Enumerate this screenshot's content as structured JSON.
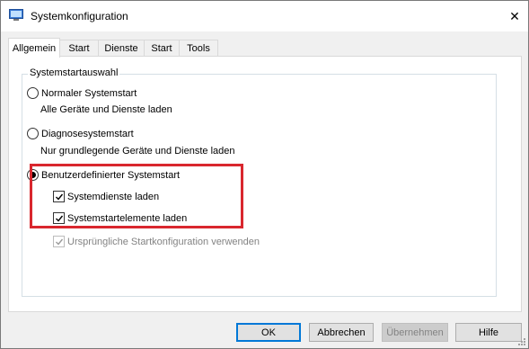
{
  "window": {
    "title": "Systemkonfiguration",
    "close_glyph": "✕"
  },
  "tabs": [
    {
      "label": "Allgemein",
      "active": true
    },
    {
      "label": "Start"
    },
    {
      "label": "Dienste"
    },
    {
      "label": "Start"
    },
    {
      "label": "Tools"
    }
  ],
  "group": {
    "label": "Systemstartauswahl",
    "normal": {
      "label": "Normaler Systemstart",
      "desc": "Alle Geräte und Dienste laden",
      "selected": false
    },
    "diagnostic": {
      "label": "Diagnosesystemstart",
      "desc": "Nur grundlegende Geräte und Dienste laden",
      "selected": false
    },
    "custom": {
      "label": "Benutzerdefinierter Systemstart",
      "selected": true
    },
    "services_check": {
      "label": "Systemdienste laden",
      "checked": true
    },
    "startup_check": {
      "label": "Systemstartelemente laden",
      "checked": true
    },
    "original_check": {
      "label": "Ursprüngliche Startkonfiguration verwenden",
      "checked": true,
      "enabled": false
    }
  },
  "buttons": {
    "ok": "OK",
    "cancel": "Abbrechen",
    "apply": "Übernehmen",
    "help": "Hilfe"
  },
  "colors": {
    "highlight": "#d9272e",
    "accent": "#0078d7"
  }
}
